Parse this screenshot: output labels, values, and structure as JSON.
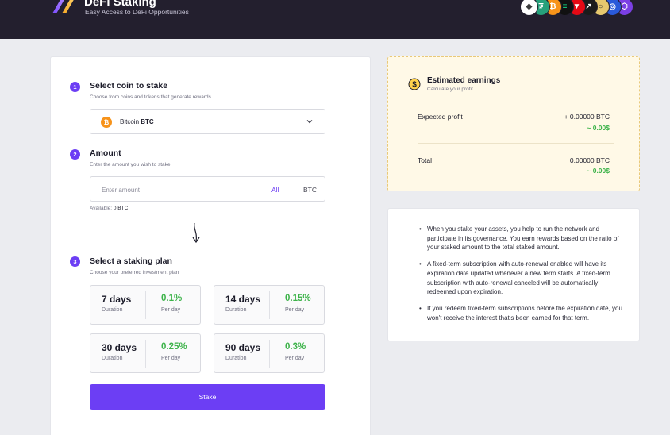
{
  "header": {
    "title": "DeFi Staking",
    "subtitle": "Easy Access to DeFi Opportunities",
    "coin_icons": [
      {
        "name": "ethereum-icon",
        "glyph": "◆",
        "color": "#ffffff",
        "fg": "#3c3c3d"
      },
      {
        "name": "tether-icon",
        "glyph": "₮",
        "color": "#26a17b",
        "fg": "#ffffff"
      },
      {
        "name": "bitcoin-icon",
        "glyph": "₿",
        "color": "#f7931a",
        "fg": "#ffffff"
      },
      {
        "name": "solana-icon",
        "glyph": "≡",
        "color": "#111111",
        "fg": "#14f195"
      },
      {
        "name": "tron-icon",
        "glyph": "▼",
        "color": "#e50915",
        "fg": "#ffffff"
      },
      {
        "name": "aave-icon",
        "glyph": "↗",
        "color": "#1b1b1b",
        "fg": "#ffffff"
      },
      {
        "name": "gold-coin-icon",
        "glyph": "○",
        "color": "#e6c86e",
        "fg": "#2b2b2b"
      },
      {
        "name": "chainlink-icon",
        "glyph": "◎",
        "color": "#2a5ada",
        "fg": "#ffffff"
      },
      {
        "name": "polygon-icon",
        "glyph": "⬡",
        "color": "#7b3fe4",
        "fg": "#ffffff"
      }
    ]
  },
  "steps": {
    "coin": {
      "number": "1",
      "title": "Select coin to stake",
      "subtitle": "Choose from coins and tokens that generate rewards."
    },
    "amount": {
      "number": "2",
      "title": "Amount",
      "subtitle": "Enter the amount you wish to stake"
    },
    "plan": {
      "number": "3",
      "title": "Select a staking plan",
      "subtitle": "Choose your preferred investment plan"
    }
  },
  "coin_select": {
    "icon_glyph": "₿",
    "name": "Bitcoin",
    "ticker": "BTC"
  },
  "amount": {
    "placeholder": "Enter amount",
    "all_label": "All",
    "unit": "BTC",
    "available_label": "Available:",
    "available_value": "0 BTC"
  },
  "plans": [
    {
      "days": "7 days",
      "duration_label": "Duration",
      "rate": "0.1%",
      "per_label": "Per day"
    },
    {
      "days": "14 days",
      "duration_label": "Duration",
      "rate": "0.15%",
      "per_label": "Per day"
    },
    {
      "days": "30 days",
      "duration_label": "Duration",
      "rate": "0.25%",
      "per_label": "Per day"
    },
    {
      "days": "90 days",
      "duration_label": "Duration",
      "rate": "0.3%",
      "per_label": "Per day"
    }
  ],
  "stake_button": "Stake",
  "earnings": {
    "title": "Estimated earnings",
    "subtitle": "Calculate your profit",
    "expected_label": "Expected profit",
    "expected_value": "+ 0.00000 BTC",
    "expected_fiat": "~ 0.00$",
    "total_label": "Total",
    "total_value": "0.00000 BTC",
    "total_fiat": "~ 0.00$"
  },
  "info": {
    "items": [
      "When you stake your assets, you help to run the network and participate in its governance. You earn rewards based on the ratio of your staked amount to the total staked amount.",
      "A fixed-term subscription with auto-renewal enabled will have its expiration date updated whenever a new term starts. A fixed-term subscription with auto-renewal canceled will be automatically redeemed upon expiration.",
      "If you redeem fixed-term subscriptions before the expiration date, you won't receive the interest that's been earned for that term."
    ]
  },
  "colors": {
    "accent": "#6c3ef4",
    "positive": "#3db34a",
    "topbar": "#231f2e",
    "earnings_bg": "#fff9e7"
  }
}
